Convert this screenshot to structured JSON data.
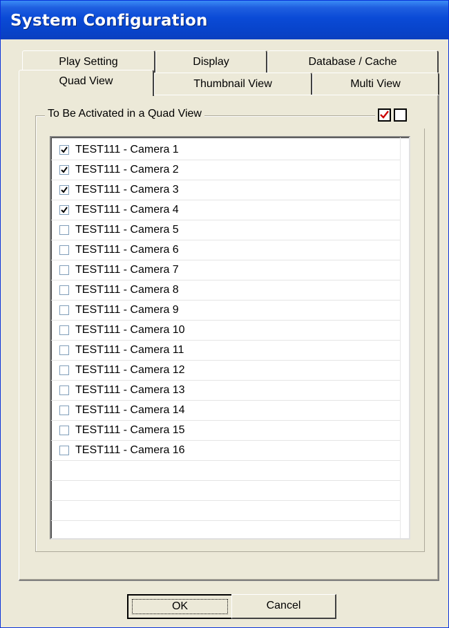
{
  "window": {
    "title": "System Configuration"
  },
  "tabs": {
    "row1": [
      "Play Setting",
      "Display",
      "Database / Cache"
    ],
    "row2": [
      "Quad View",
      "Thumbnail View",
      "Multi View"
    ],
    "active": "Quad View"
  },
  "group": {
    "label": "To Be Activated in a Quad View",
    "check_all_icon": "check-all-icon",
    "uncheck_all_icon": "uncheck-all-icon",
    "accent_color": "#cc0000"
  },
  "cameras": [
    {
      "label": "TEST111 - Camera 1",
      "checked": true
    },
    {
      "label": "TEST111 - Camera 2",
      "checked": true
    },
    {
      "label": "TEST111 - Camera 3",
      "checked": true
    },
    {
      "label": "TEST111 - Camera 4",
      "checked": true
    },
    {
      "label": "TEST111 - Camera 5",
      "checked": false
    },
    {
      "label": "TEST111 - Camera 6",
      "checked": false
    },
    {
      "label": "TEST111 - Camera 7",
      "checked": false
    },
    {
      "label": "TEST111 - Camera 8",
      "checked": false
    },
    {
      "label": "TEST111 - Camera 9",
      "checked": false
    },
    {
      "label": "TEST111 - Camera 10",
      "checked": false
    },
    {
      "label": "TEST111 - Camera 11",
      "checked": false
    },
    {
      "label": "TEST111 - Camera 12",
      "checked": false
    },
    {
      "label": "TEST111 - Camera 13",
      "checked": false
    },
    {
      "label": "TEST111 - Camera 14",
      "checked": false
    },
    {
      "label": "TEST111 - Camera 15",
      "checked": false
    },
    {
      "label": "TEST111 - Camera 16",
      "checked": false
    }
  ],
  "buttons": {
    "ok": "OK",
    "cancel": "Cancel"
  }
}
